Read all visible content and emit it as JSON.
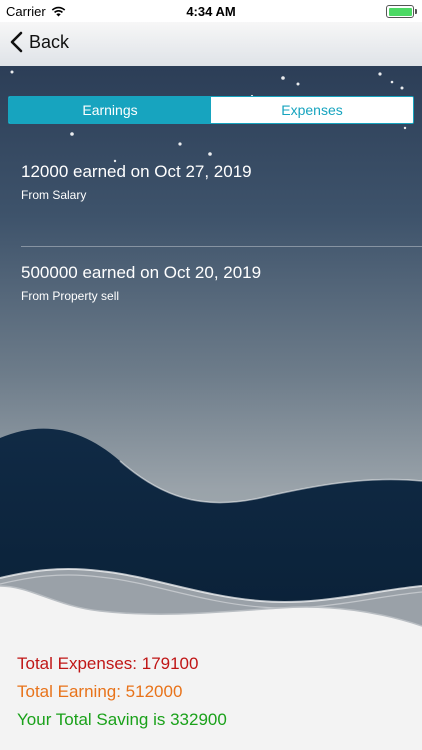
{
  "status_bar": {
    "carrier": "Carrier",
    "time": "4:34 AM",
    "wifi_icon": "wifi-icon",
    "battery_icon": "battery-icon",
    "battery_color": "#4cd964"
  },
  "nav": {
    "back_label": "Back",
    "back_icon": "chevron-left-icon"
  },
  "segments": {
    "earnings_label": "Earnings",
    "expenses_label": "Expenses",
    "selected": "Earnings",
    "accent_color": "#17a4bf"
  },
  "entries": [
    {
      "title": "12000 earned on Oct 27, 2019",
      "subtitle": "From Salary"
    },
    {
      "title": "500000 earned on Oct 20, 2019",
      "subtitle": "From Property sell"
    }
  ],
  "totals": {
    "expenses": "Total Expenses: 179100",
    "earning": "Total Earning: 512000",
    "saving": "Your Total Saving is 332900",
    "expenses_color": "#c01616",
    "earning_color": "#e8731a",
    "saving_color": "#1aa11a"
  }
}
